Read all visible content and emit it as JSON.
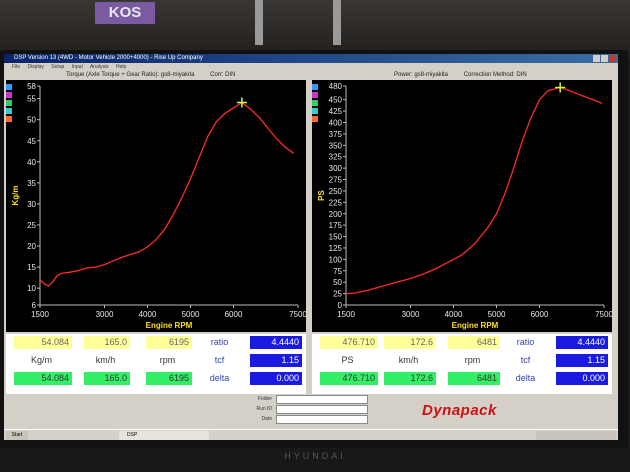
{
  "environment": {
    "poster_text": "KOS",
    "monitor_brand": "HYUNDAI"
  },
  "window": {
    "title": "DSP Version 13 (4WD - Motor Vehicle 2000+4000) - Rise Up Company",
    "menu": [
      "File",
      "Display",
      "Setup",
      "Input",
      "Analysis",
      "Help"
    ]
  },
  "left_info": {
    "title": "Torque (Axle Torque + Gear Ratio): gs8-miyakita",
    "corr": "Corr: DIN"
  },
  "right_info": {
    "title": "Power: gs8-miyakita",
    "corr": "Correction Method: DIN"
  },
  "chart_data": [
    {
      "type": "line",
      "ylabel": "Kg/m",
      "xlabel": "Engine RPM",
      "xlim": [
        1500,
        7500
      ],
      "ylim": [
        6,
        58
      ],
      "x_ticks": [
        1500,
        3000,
        4000,
        5000,
        6000,
        7500
      ],
      "y_ticks": [
        6,
        10,
        15,
        20,
        25,
        30,
        35,
        40,
        45,
        50,
        55,
        58
      ],
      "grid": false,
      "line_color": "#ff2a2a",
      "marker": {
        "x": 6195,
        "y": 54.084,
        "color": "#ccff33"
      },
      "series": [
        {
          "x": [
            1500,
            1600,
            1700,
            1800,
            1900,
            2000,
            2200,
            2400,
            2600,
            2800,
            3000,
            3200,
            3400,
            3600,
            3800,
            4000,
            4200,
            4400,
            4600,
            4800,
            5000,
            5200,
            5400,
            5600,
            5800,
            6000,
            6195,
            6400,
            6600,
            6800,
            7000,
            7200,
            7400
          ],
          "y": [
            12.0,
            11.0,
            10.5,
            11.5,
            13.0,
            13.5,
            13.8,
            14.2,
            14.8,
            15.0,
            15.6,
            16.5,
            17.3,
            18.0,
            18.6,
            19.8,
            21.5,
            24.0,
            27.5,
            31.5,
            36.0,
            41.0,
            46.0,
            49.5,
            51.5,
            52.8,
            54.084,
            52.5,
            50.5,
            48.0,
            45.5,
            43.5,
            42.0
          ]
        }
      ]
    },
    {
      "type": "line",
      "ylabel": "PS",
      "xlabel": "Engine RPM",
      "xlim": [
        1500,
        7500
      ],
      "ylim": [
        0,
        480
      ],
      "x_ticks": [
        1500,
        3000,
        4000,
        5000,
        6000,
        7500
      ],
      "y_ticks": [
        0,
        25,
        50,
        75,
        100,
        125,
        150,
        175,
        200,
        225,
        250,
        275,
        300,
        325,
        350,
        375,
        400,
        425,
        450,
        480
      ],
      "grid": false,
      "line_color": "#ff2a2a",
      "marker": {
        "x": 6481,
        "y": 476.71,
        "color": "#ccff33"
      },
      "series": [
        {
          "x": [
            1500,
            1700,
            2000,
            2300,
            2600,
            3000,
            3300,
            3600,
            3900,
            4200,
            4500,
            4800,
            5000,
            5200,
            5400,
            5600,
            5800,
            6000,
            6200,
            6481,
            6700,
            6900,
            7100,
            7300,
            7450
          ],
          "y": [
            25,
            26,
            32,
            40,
            48,
            58,
            68,
            80,
            95,
            110,
            135,
            170,
            200,
            245,
            300,
            360,
            410,
            450,
            470,
            476.71,
            470,
            462,
            455,
            448,
            442
          ]
        }
      ]
    }
  ],
  "left_readout": {
    "torque": "54.084",
    "speed": "165.0",
    "rpm": "6195",
    "unit_torque": "Kg/m",
    "unit_speed": "km/h",
    "unit_rpm": "rpm",
    "ratio_label": "ratio",
    "ratio_value": "4.4440",
    "tcf_label": "tcf",
    "tcf_value": "1.15",
    "delta_label": "delta",
    "delta_value": "0.000"
  },
  "right_readout": {
    "power": "476.710",
    "speed": "172.6",
    "rpm": "6481",
    "unit_power": "PS",
    "unit_speed": "km/h",
    "unit_rpm": "rpm",
    "ratio_label": "ratio",
    "ratio_value": "4.4440",
    "tcf_label": "tcf",
    "tcf_value": "1.15",
    "delta_label": "delta",
    "delta_value": "0.000"
  },
  "footer": {
    "folder_label": "Folder",
    "runid_label": "Run ID",
    "date_label": "Date",
    "logo_text": "Dynapack"
  },
  "taskbar": {
    "start": "Start",
    "task": "DSP",
    "clock": ""
  },
  "colors": {
    "series": "#ff2a2a",
    "marker": "#ccff33",
    "value_fill": "#ffff99",
    "live_fill": "#33ee66",
    "param_fill": "#1a1ae0"
  }
}
